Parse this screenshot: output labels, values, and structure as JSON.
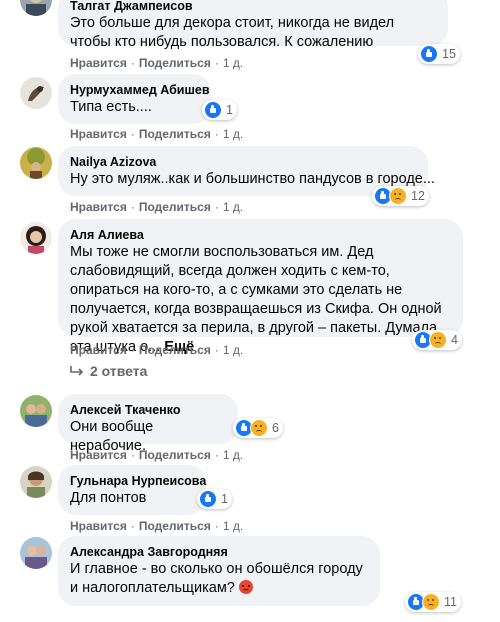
{
  "actions": {
    "like": "Нравится",
    "share": "Поделиться",
    "sep": "·"
  },
  "comments": [
    {
      "author": "Талгат Джампеисов",
      "text": "Это больше для декора стоит, никогда не видел чтобы кто нибудь пользовался. К сожалению",
      "time": "1 д.",
      "reactions": [
        "like"
      ],
      "count": "15"
    },
    {
      "author": "Нурмухаммед Абишев",
      "text": "Типа есть....",
      "time": "1 д.",
      "reactions": [
        "like"
      ],
      "count": "1"
    },
    {
      "author": "Nailya Azizova",
      "text": "Ну это муляж..как и большинство пандусов в городе...",
      "time": "1 д.",
      "reactions": [
        "like",
        "sad"
      ],
      "count": "12"
    },
    {
      "author": "Аля Алиева",
      "text": "Мы тоже не смогли воспользоваться им. Дед слабовидящий, всегда должен ходить с кем-то, опираться на кого-то, а с сумками это сделать не получается, когда возвращаешься из Скифа. Он одной рукой хватается за перила, в другой – пакеты. Думала, эта штука о...",
      "more": "Ещё",
      "time": "1 д.",
      "reactions": [
        "like",
        "sad"
      ],
      "count": "4",
      "replies": "2 ответа"
    },
    {
      "author": "Алексей Ткаченко",
      "text": "Они вообще нерабочие.",
      "time": "1 д.",
      "reactions": [
        "like",
        "sad"
      ],
      "count": "6"
    },
    {
      "author": "Гульнара Нурпеисова",
      "text": "Для понтов",
      "time": "1 д.",
      "reactions": [
        "like"
      ],
      "count": "1"
    },
    {
      "author": "Александра Завгородняя",
      "text": "И главное - во сколько он обошёлся городу и налогоплательщикам?",
      "emoji": "angry-face",
      "time": "1 д.",
      "reactions": [
        "like",
        "sad"
      ],
      "count": "11"
    }
  ]
}
